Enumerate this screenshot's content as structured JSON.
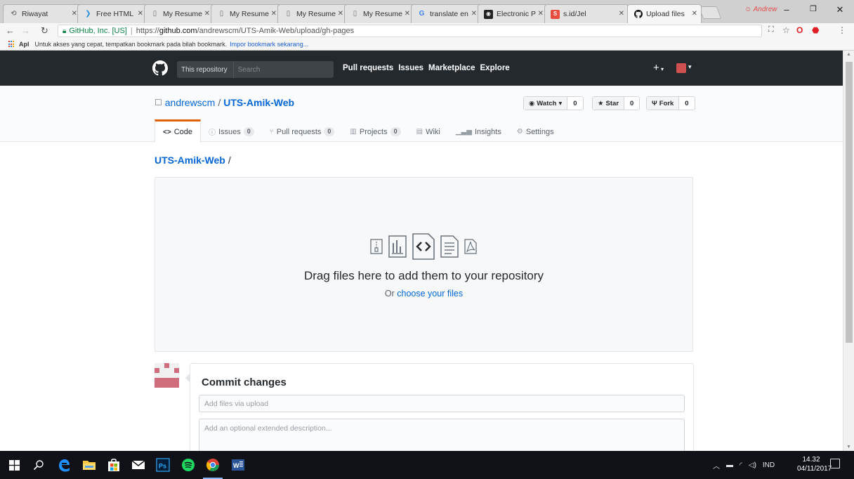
{
  "browser": {
    "tabs": [
      {
        "title": "Riwayat",
        "icon": "history-icon",
        "active": false
      },
      {
        "title": "Free HTML L",
        "icon": "brand-icon",
        "active": false
      },
      {
        "title": "My Resume",
        "icon": "page-icon",
        "active": false
      },
      {
        "title": "My Resume",
        "icon": "page-icon",
        "active": false
      },
      {
        "title": "My Resume",
        "icon": "page-icon",
        "active": false
      },
      {
        "title": "My Resume",
        "icon": "page-icon",
        "active": false
      },
      {
        "title": "translate en",
        "icon": "google-icon",
        "active": false
      },
      {
        "title": "Electronic P",
        "icon": "camera-icon",
        "active": false
      },
      {
        "title": "s.id/Jel",
        "icon": "sid-icon",
        "active": false
      },
      {
        "title": "Upload files",
        "icon": "github-icon",
        "active": true
      }
    ],
    "profile_name": "Andrew",
    "address": {
      "secure_label": "GitHub, Inc. [US]",
      "protocol": "https://",
      "host": "github.com",
      "path": "/andrewscm/UTS-Amik-Web/upload/gh-pages"
    },
    "bookmarks": {
      "apps_label": "Apl",
      "message": "Untuk akses yang cepat, tempatkan bookmark pada bilah bookmark.",
      "import_link": "Impor bookmark sekarang..."
    }
  },
  "github": {
    "header": {
      "scope_label": "This repository",
      "search_placeholder": "Search",
      "nav": [
        "Pull requests",
        "Issues",
        "Marketplace",
        "Explore"
      ],
      "plus_label": "+"
    },
    "repo": {
      "owner": "andrewscm",
      "separator": "/",
      "name": "UTS-Amik-Web",
      "watch": {
        "label": "Watch",
        "count": "0"
      },
      "star": {
        "label": "Star",
        "count": "0"
      },
      "fork": {
        "label": "Fork",
        "count": "0"
      }
    },
    "tabs": [
      {
        "label": "Code",
        "icon": "code-icon",
        "count": null,
        "selected": true
      },
      {
        "label": "Issues",
        "icon": "issue-icon",
        "count": "0",
        "selected": false
      },
      {
        "label": "Pull requests",
        "icon": "pull-request-icon",
        "count": "0",
        "selected": false
      },
      {
        "label": "Projects",
        "icon": "project-icon",
        "count": "0",
        "selected": false
      },
      {
        "label": "Wiki",
        "icon": "wiki-icon",
        "count": null,
        "selected": false
      },
      {
        "label": "Insights",
        "icon": "graph-icon",
        "count": null,
        "selected": false
      },
      {
        "label": "Settings",
        "icon": "gear-icon",
        "count": null,
        "selected": false
      }
    ],
    "breadcrumb": {
      "repo": "UTS-Amik-Web",
      "separator": "/"
    },
    "dropzone": {
      "headline": "Drag files here to add them to your repository",
      "or_text": "Or",
      "choose_link": "choose your files"
    },
    "commit": {
      "title": "Commit changes",
      "summary_placeholder": "Add files via upload",
      "description_placeholder": "Add an optional extended description..."
    }
  },
  "taskbar": {
    "language": "IND",
    "time": "14.32",
    "date": "04/11/2017",
    "apps": [
      "windows-start-icon",
      "search-icon",
      "edge-icon",
      "file-explorer-icon",
      "store-icon",
      "mail-icon",
      "photoshop-icon",
      "spotify-icon",
      "chrome-icon",
      "word-icon"
    ]
  },
  "colors": {
    "github_header": "#24292e",
    "link_blue": "#0366d6",
    "tab_accent": "#e36209",
    "secure_green": "#0b8043"
  }
}
